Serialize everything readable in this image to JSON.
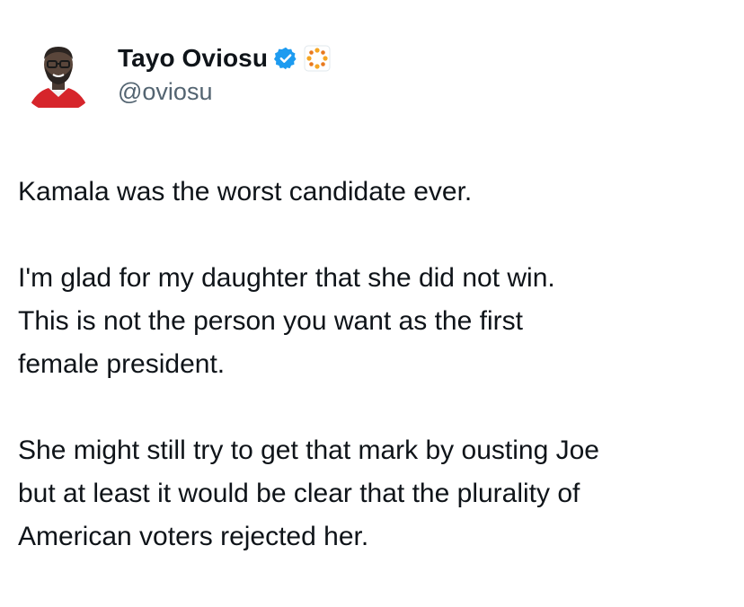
{
  "author": {
    "display_name": "Tayo Oviosu",
    "handle": "@oviosu",
    "avatar_icon": "profile-photo",
    "verified_icon": "verified-badge-icon",
    "verified_color": "#1d9bf0",
    "affiliate_icon": "organization-affiliate-icon",
    "affiliate_color": "#f5a623"
  },
  "tweet": {
    "paragraphs": [
      {
        "lines": [
          "Kamala was the worst candidate ever."
        ]
      },
      {
        "lines": [
          "I'm glad for my daughter that she did not win.",
          "This is not the person you want as the first",
          "female president."
        ]
      },
      {
        "lines": [
          "She might still try to get that mark by ousting Joe",
          "but at least it would be clear that the plurality of",
          "American voters rejected her."
        ]
      }
    ]
  }
}
